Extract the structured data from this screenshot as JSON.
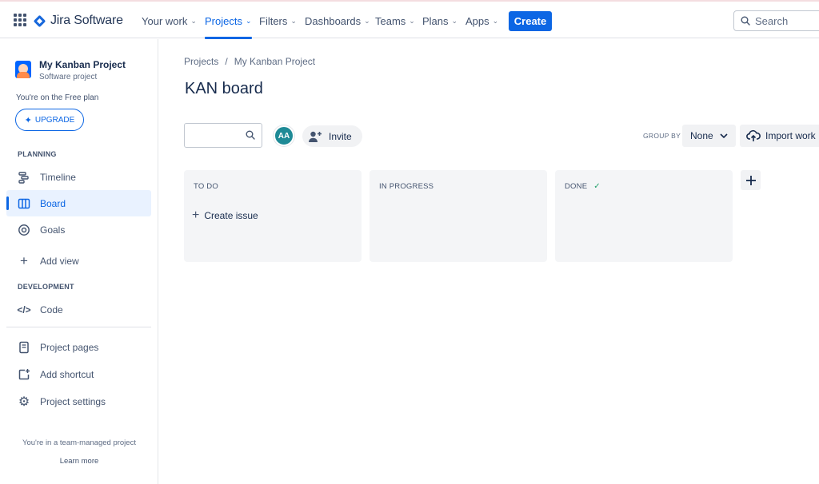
{
  "topnav": {
    "app_name": "Jira Software",
    "items": [
      {
        "label": "Your work"
      },
      {
        "label": "Projects"
      },
      {
        "label": "Filters"
      },
      {
        "label": "Dashboards"
      },
      {
        "label": "Teams"
      },
      {
        "label": "Plans"
      },
      {
        "label": "Apps"
      }
    ],
    "active_item": "Projects",
    "create_label": "Create",
    "search_placeholder": "Search"
  },
  "sidebar": {
    "project_name": "My Kanban Project",
    "project_type": "Software project",
    "plan_text": "You're on the Free plan",
    "upgrade_label": "UPGRADE",
    "planning_heading": "PLANNING",
    "planning_items": [
      {
        "label": "Timeline",
        "icon": "timeline-icon"
      },
      {
        "label": "Board",
        "icon": "board-icon"
      },
      {
        "label": "Goals",
        "icon": "goals-icon"
      },
      {
        "label": "Add view",
        "icon": "plus-icon"
      }
    ],
    "selected_item": "Board",
    "development_heading": "DEVELOPMENT",
    "development_items": [
      {
        "label": "Code",
        "icon": "code-icon"
      }
    ],
    "bottom_items": [
      {
        "label": "Project pages",
        "icon": "page-icon"
      },
      {
        "label": "Add shortcut",
        "icon": "add-shortcut-icon"
      },
      {
        "label": "Project settings",
        "icon": "gear-icon"
      }
    ],
    "footer_text": "You're in a team-managed project",
    "footer_link": "Learn more"
  },
  "main": {
    "breadcrumbs": [
      "Projects",
      "My Kanban Project"
    ],
    "breadcrumb_separator": "/",
    "title": "KAN board",
    "board_search_value": "",
    "avatar_initials": "AA",
    "invite_label": "Invite",
    "group_by_label": "GROUP BY",
    "group_by_value": "None",
    "import_label": "Import work",
    "columns": [
      {
        "title": "TO DO",
        "create_label": "Create issue"
      },
      {
        "title": "IN PROGRESS"
      },
      {
        "title": "DONE",
        "done_icon": "check-icon"
      }
    ]
  },
  "colors": {
    "accent": "#0c66e4",
    "avatar_bg": "#1e8a96",
    "column_bg": "#f4f5f7",
    "done_check": "#22a06b"
  }
}
